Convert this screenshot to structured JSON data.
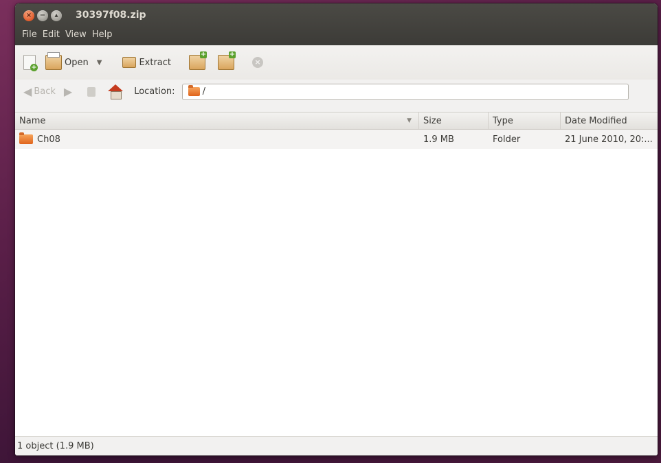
{
  "window": {
    "title": "30397f08.zip"
  },
  "menu": [
    "File",
    "Edit",
    "View",
    "Help"
  ],
  "toolbar": {
    "open_label": "Open",
    "extract_label": "Extract"
  },
  "navigation": {
    "back_label": "Back",
    "location_label": "Location:",
    "location_value": "/"
  },
  "columns": [
    "Name",
    "Size",
    "Type",
    "Date Modified"
  ],
  "rows": [
    {
      "name": "Ch08",
      "size": "1.9 MB",
      "type": "Folder",
      "date": "21 June 2010, 20:..."
    }
  ],
  "status": "1 object (1.9 MB)",
  "icons": {
    "new": "new-archive-icon",
    "open": "open-archive-icon",
    "extract": "extract-icon",
    "add_files": "add-files-icon",
    "add_folder": "add-folder-icon",
    "stop": "stop-icon",
    "back": "back-arrow-icon",
    "forward": "forward-arrow-icon",
    "up": "up-icon",
    "home": "home-icon",
    "folder": "folder-icon"
  },
  "colors": {
    "titlebar": "#3c3b37",
    "close_button": "#e05a2a",
    "folder": "#e0641c"
  }
}
